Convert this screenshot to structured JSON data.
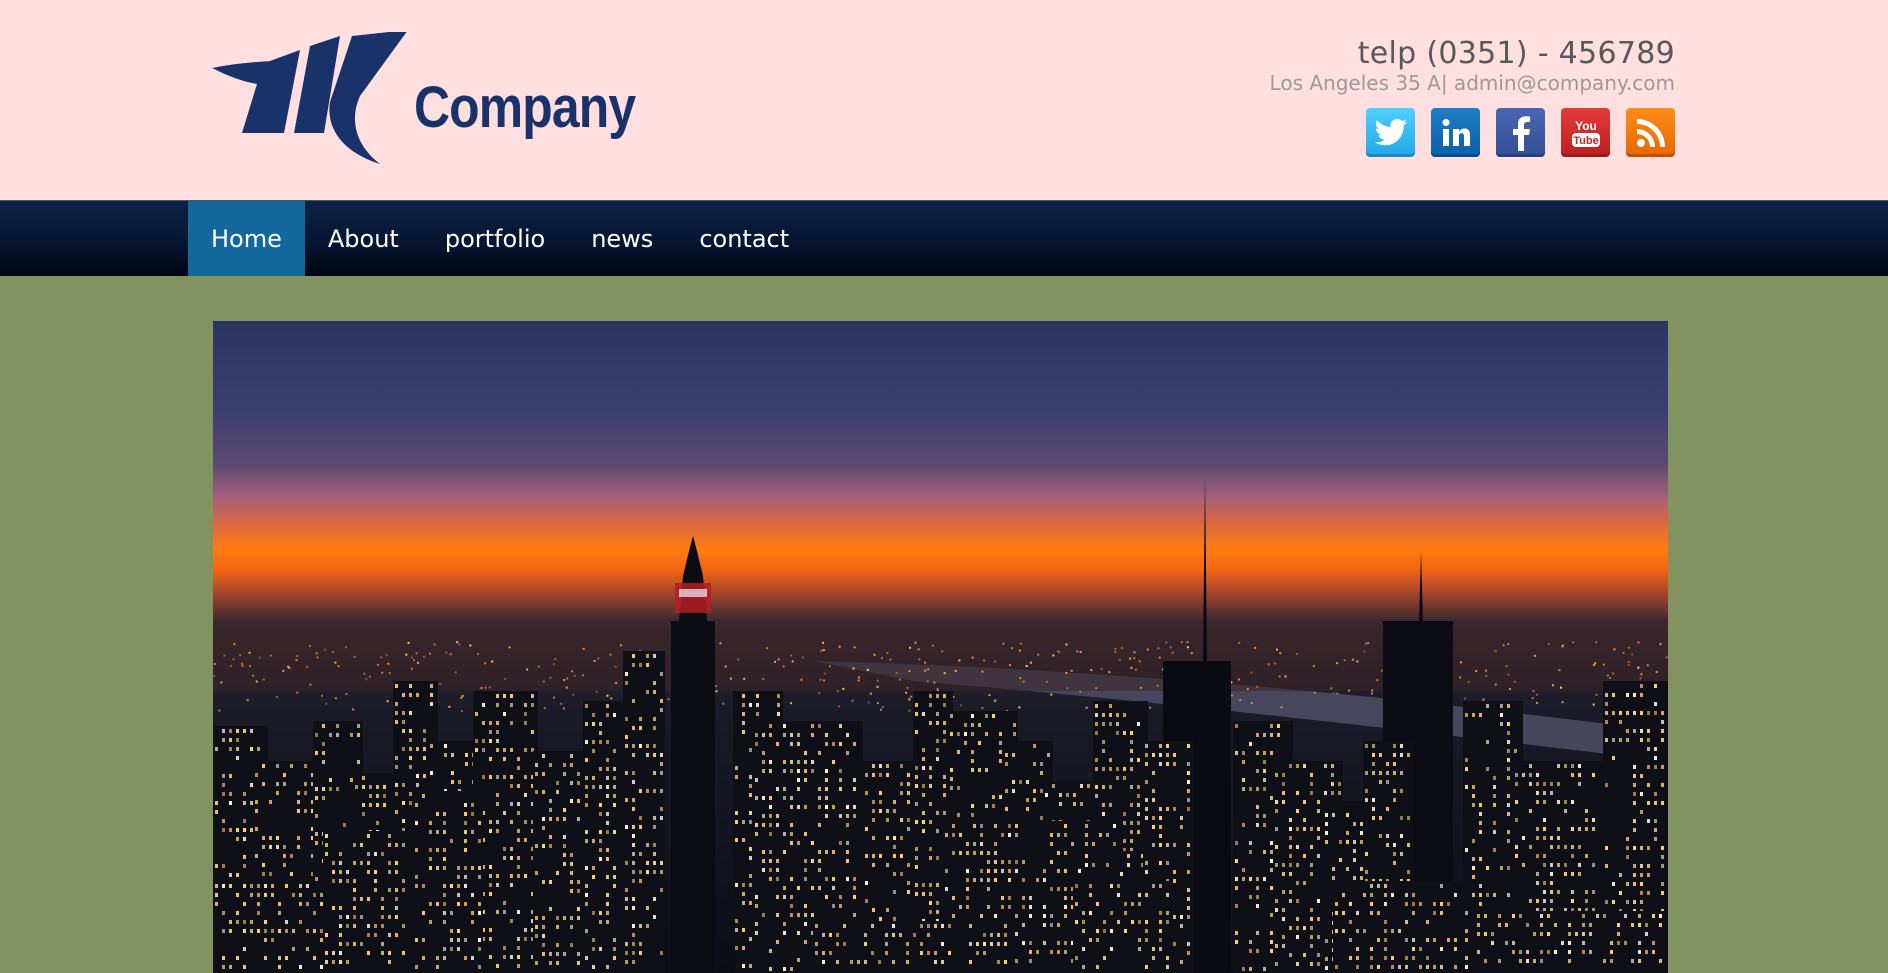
{
  "brand": {
    "name": "Company",
    "logo_color": "#1a326a"
  },
  "contact": {
    "phone": "telp (0351) - 456789",
    "address": "Los Angeles 35 A| admin@company.com"
  },
  "social": [
    {
      "name": "twitter",
      "icon": "twitter-icon",
      "color": "#20a8e6"
    },
    {
      "name": "linkedin",
      "icon": "linkedin-icon",
      "color": "#0b5fa8"
    },
    {
      "name": "facebook",
      "icon": "facebook-icon",
      "color": "#324e93"
    },
    {
      "name": "youtube",
      "icon": "youtube-icon",
      "color": "#b81f1f",
      "label_top": "You",
      "label_bottom": "Tube"
    },
    {
      "name": "rss",
      "icon": "rss-icon",
      "color": "#ea6500"
    }
  ],
  "nav": {
    "items": [
      {
        "label": "Home",
        "active": true
      },
      {
        "label": "About",
        "active": false
      },
      {
        "label": "portfolio",
        "active": false
      },
      {
        "label": "news",
        "active": false
      },
      {
        "label": "contact",
        "active": false
      }
    ]
  },
  "hero": {
    "image": "city-skyline-at-sunset"
  },
  "colors": {
    "header_bg": "#ffdfe0",
    "nav_active": "#13689e",
    "page_bg": "#82935f"
  }
}
